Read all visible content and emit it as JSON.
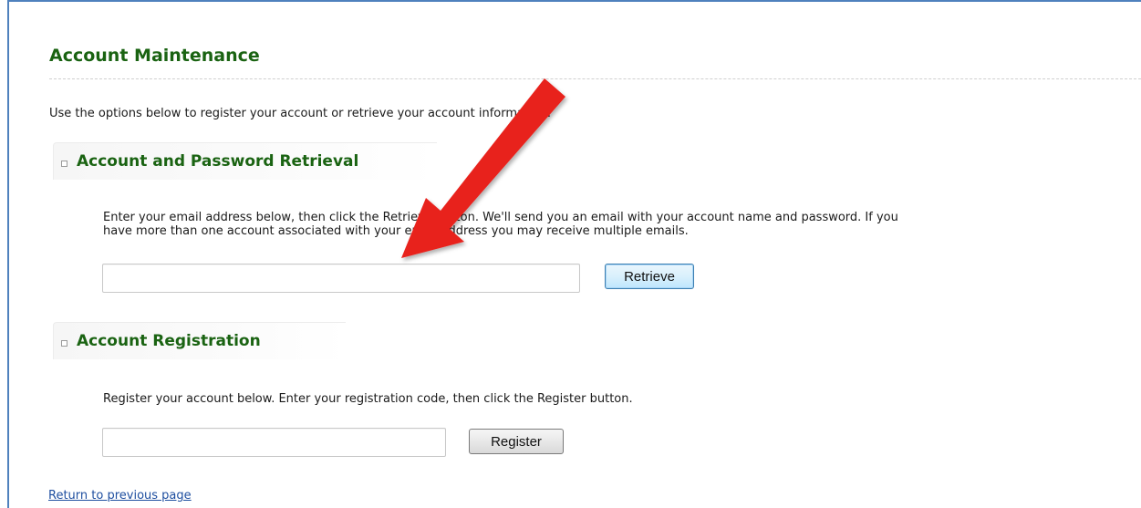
{
  "page": {
    "title": "Account Maintenance",
    "intro": "Use the options below to register your account or retrieve your account information."
  },
  "retrieval": {
    "heading": "Account and Password Retrieval",
    "description_line1": "Enter your email address below, then click the Retrieve button. We'll send you an email with your account name and password. If you",
    "description_line2": "have more than one account associated with your email address you may receive multiple emails.",
    "email_value": "",
    "button_label": "Retrieve"
  },
  "registration": {
    "heading": "Account Registration",
    "description": "Register your account below. Enter your registration code, then click the Register button.",
    "code_value": "",
    "button_label": "Register"
  },
  "footer": {
    "return_link": "Return to previous page"
  },
  "colors": {
    "heading_green": "#1a6312",
    "link_blue": "#1f4fa0",
    "annotation_red": "#e8201c",
    "frame_blue": "#4f81bd"
  }
}
